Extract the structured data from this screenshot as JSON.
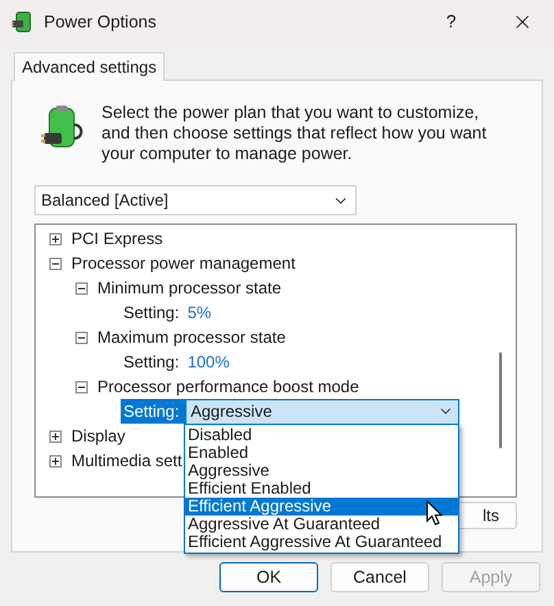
{
  "window": {
    "title": "Power Options",
    "help": "?"
  },
  "tabs": [
    {
      "label": "Advanced settings",
      "selected": true
    }
  ],
  "description": "Select the power plan that you want to customize, and then choose settings that reflect how you want your computer to manage power.",
  "plan_dropdown": {
    "value": "Balanced [Active]"
  },
  "tree": [
    {
      "kind": "group",
      "label": "PCI Express",
      "expanded": false
    },
    {
      "kind": "group",
      "label": "Processor power management",
      "expanded": true,
      "children": [
        {
          "kind": "group",
          "label": "Minimum processor state",
          "expanded": true,
          "children": [
            {
              "kind": "setting",
              "label": "Setting:",
              "value": "5%"
            }
          ]
        },
        {
          "kind": "group",
          "label": "Maximum processor state",
          "expanded": true,
          "children": [
            {
              "kind": "setting",
              "label": "Setting:",
              "value": "100%"
            }
          ]
        },
        {
          "kind": "group",
          "label": "Processor performance boost mode",
          "expanded": true,
          "children": [
            {
              "kind": "combo",
              "label": "Setting:",
              "value": "Aggressive",
              "selected": true
            }
          ]
        }
      ]
    },
    {
      "kind": "group",
      "label": "Display",
      "expanded": false
    },
    {
      "kind": "group",
      "label": "Multimedia sett",
      "expanded": false
    }
  ],
  "restore_button": {
    "label": "lts"
  },
  "dropdown_options": [
    {
      "label": "Disabled",
      "selected": false
    },
    {
      "label": "Enabled",
      "selected": false
    },
    {
      "label": "Aggressive",
      "selected": false
    },
    {
      "label": "Efficient Enabled",
      "selected": false
    },
    {
      "label": "Efficient Aggressive",
      "selected": true
    },
    {
      "label": "Aggressive At Guaranteed",
      "selected": false
    },
    {
      "label": "Efficient Aggressive At Guaranteed",
      "selected": false
    }
  ],
  "buttons": [
    {
      "label": "OK",
      "default": true,
      "disabled": false
    },
    {
      "label": "Cancel",
      "default": false,
      "disabled": false
    },
    {
      "label": "Apply",
      "default": false,
      "disabled": true
    }
  ]
}
